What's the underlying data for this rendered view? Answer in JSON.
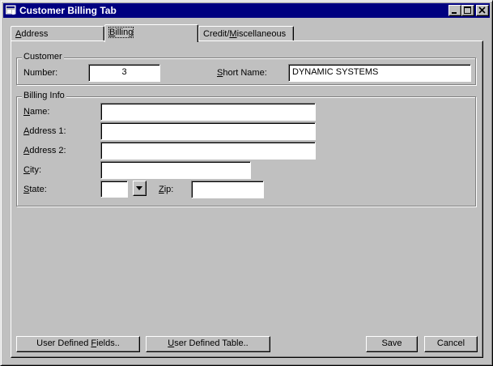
{
  "window": {
    "title": "Customer Billing Tab"
  },
  "tabs": [
    {
      "pre": "",
      "key": "A",
      "post": "ddress"
    },
    {
      "pre": "",
      "key": "B",
      "post": "illing"
    },
    {
      "pre": "Credit/",
      "key": "M",
      "post": "iscellaneous"
    }
  ],
  "active_tab": "Billing",
  "customer_group": {
    "title": "Customer",
    "number_label": "Number:",
    "number_value": "3",
    "short_name_label_pre": "",
    "short_name_label_key": "S",
    "short_name_label_post": "hort Name:",
    "short_name_value": "DYNAMIC SYSTEMS"
  },
  "billing_group": {
    "title": "Billing Info",
    "name_label": {
      "key": "N",
      "post": "ame:"
    },
    "address1_label": {
      "key": "A",
      "post": "ddress 1:"
    },
    "address2_label": {
      "key": "A",
      "post": "ddress 2:"
    },
    "city_label": {
      "key": "C",
      "post": "ity:"
    },
    "state_label": {
      "key": "S",
      "post": "tate:"
    },
    "zip_label": {
      "key": "Z",
      "post": "ip:"
    },
    "name_value": "",
    "address1_value": "",
    "address2_value": "",
    "city_value": "",
    "state_value": "",
    "zip_value": ""
  },
  "buttons": {
    "user_defined_fields": {
      "pre": "User Defined ",
      "key": "F",
      "post": "ields.."
    },
    "user_defined_table": {
      "pre": "",
      "key": "U",
      "post": "ser Defined Table.."
    },
    "save": "Save",
    "cancel": "Cancel"
  },
  "icons": {
    "app": "app-window-icon",
    "minimize": "minimize-icon",
    "maximize": "maximize-icon",
    "close": "close-icon",
    "dropdown": "chevron-down-icon"
  },
  "colors": {
    "titlebar": "#000080",
    "face": "#c0c0c0"
  }
}
